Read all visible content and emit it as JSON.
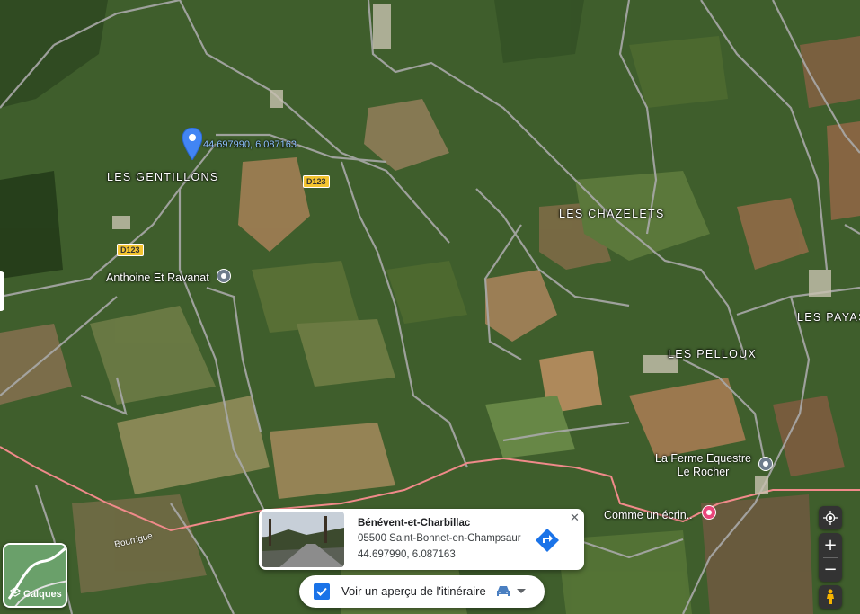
{
  "marker": {
    "coords": "44.697990, 6.087163",
    "place": "LES GENTILLONS"
  },
  "places": {
    "chazelets": "LES CHAZELETS",
    "payas": "LES PAYAS",
    "pelloux": "LES PELLOUX"
  },
  "roads": {
    "d123_top": "D123",
    "d123_left": "D123",
    "bourrigue": "Bourrigue"
  },
  "pois": {
    "antoine": "Anthoine Et Ravanat",
    "ferme_line1": "La Ferme Equestre",
    "ferme_line2": "Le Rocher",
    "ecrin": "Comme un écrin.."
  },
  "card": {
    "title": "Bénévent-et-Charbillac",
    "address": "05500 Saint-Bonnet-en-Champsaur",
    "coords": "44.697990, 6.087163",
    "close": "✕"
  },
  "route_bar": {
    "label": "Voir un aperçu de l'itinéraire"
  },
  "layers": {
    "label": "Calques"
  },
  "zoom": {
    "in": "+",
    "out": "−"
  },
  "colors": {
    "accent": "#1a73e8",
    "boundary": "#f08080",
    "pin": "#4285f4"
  }
}
